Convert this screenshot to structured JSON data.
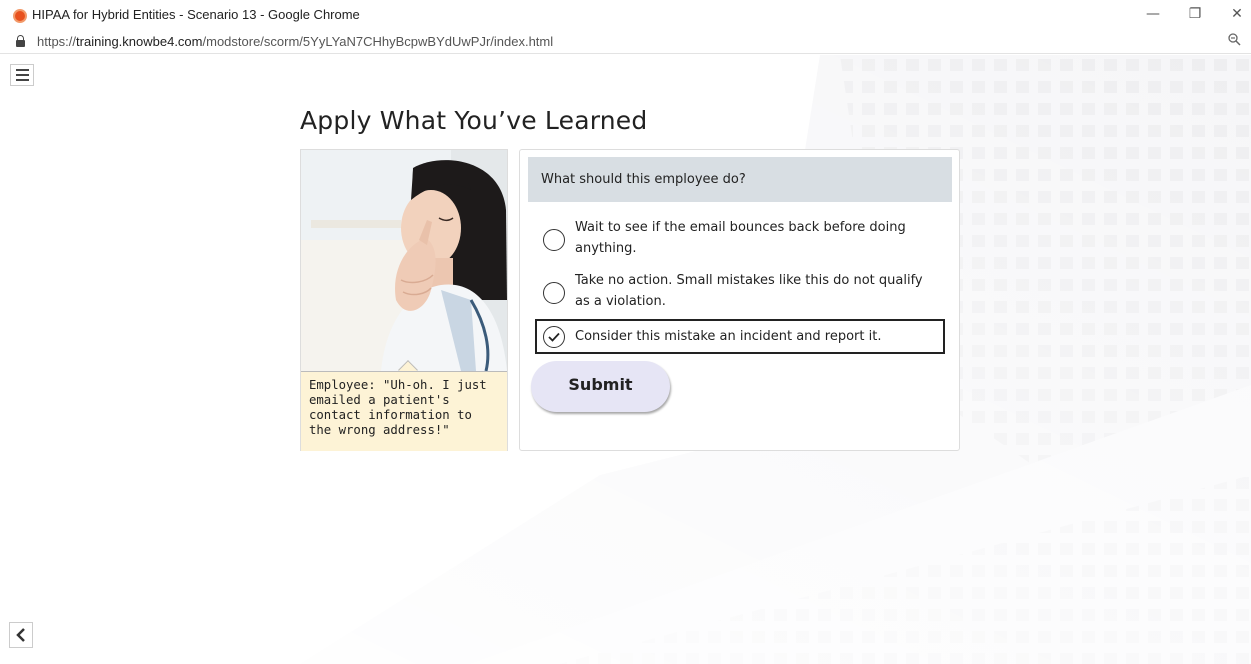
{
  "window": {
    "title": "HIPAA for Hybrid Entities - Scenario 13 - Google Chrome",
    "minimize_glyph": "—",
    "restore_glyph": "❐",
    "close_glyph": "✕"
  },
  "addressbar": {
    "url_prefix": "https://",
    "url_domain": "training.knowbe4.com",
    "url_path": "/modstore/scorm/5YyLYaN7CHhyBcpwBYdUwPJr/index.html"
  },
  "page": {
    "heading": "Apply What You’ve Learned"
  },
  "scenario": {
    "caption": "Employee: \"Uh-oh. I just emailed a patient's contact information to the wrong address!\""
  },
  "question": {
    "prompt": "What should this employee do?",
    "options": [
      {
        "label": "Wait to see if the email bounces back before doing anything.",
        "selected": false
      },
      {
        "label": "Take no action. Small mistakes like this do not qualify as a violation.",
        "selected": false
      },
      {
        "label": "Consider this mistake an incident and report it.",
        "selected": true
      }
    ],
    "submit_label": "Submit"
  },
  "colors": {
    "accent_header": "#d8dee3",
    "caption_bg": "#fdf3d6",
    "submit_bg": "#e6e5f5"
  }
}
